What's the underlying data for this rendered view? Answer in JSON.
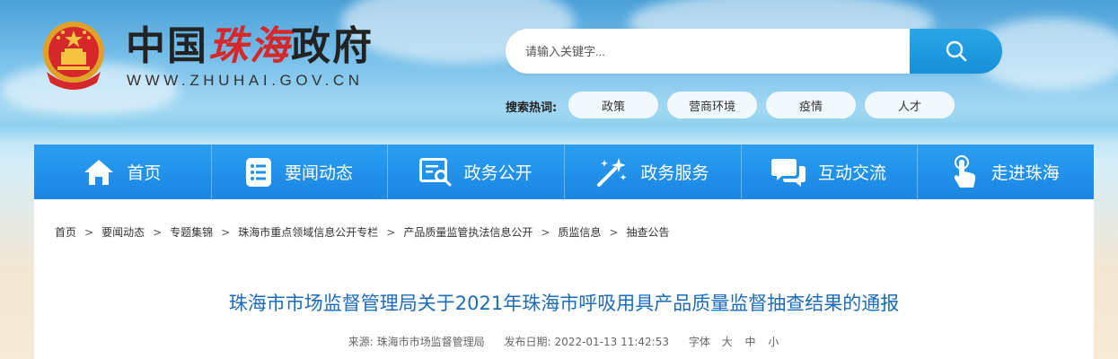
{
  "header": {
    "site_name_prefix": "中国",
    "site_name_accent": "珠海",
    "site_name_suffix": "政府",
    "site_url": "WWW.ZHUHAI.GOV.CN"
  },
  "search": {
    "placeholder": "请输入关键字...",
    "hot_label": "搜索热词:",
    "hot_words": [
      "政策",
      "营商环境",
      "疫情",
      "人才"
    ]
  },
  "nav": {
    "items": [
      {
        "label": "首页",
        "icon": "home-icon"
      },
      {
        "label": "要闻动态",
        "icon": "news-list-icon"
      },
      {
        "label": "政务公开",
        "icon": "document-search-icon"
      },
      {
        "label": "政务服务",
        "icon": "magic-wand-icon"
      },
      {
        "label": "互动交流",
        "icon": "chat-bubbles-icon"
      },
      {
        "label": "走进珠海",
        "icon": "tap-hand-icon"
      }
    ]
  },
  "breadcrumb": [
    "首页",
    "要闻动态",
    "专题集锦",
    "珠海市重点领域信息公开专栏",
    "产品质量监管执法信息公开",
    "质监信息",
    "抽查公告"
  ],
  "article": {
    "title": "珠海市市场监督管理局关于2021年珠海市呼吸用具产品质量监督抽查结果的通报",
    "source_label": "来源:",
    "source": "珠海市市场监督管理局",
    "date_label": "发布日期:",
    "date": "2022-01-13 11:42:53",
    "font_label": "字体",
    "font_large": "大",
    "font_medium": "中",
    "font_small": "小"
  },
  "colors": {
    "nav_blue": "#1b86e3",
    "title_blue": "#1c6bb8",
    "accent_red": "#d6282a"
  }
}
